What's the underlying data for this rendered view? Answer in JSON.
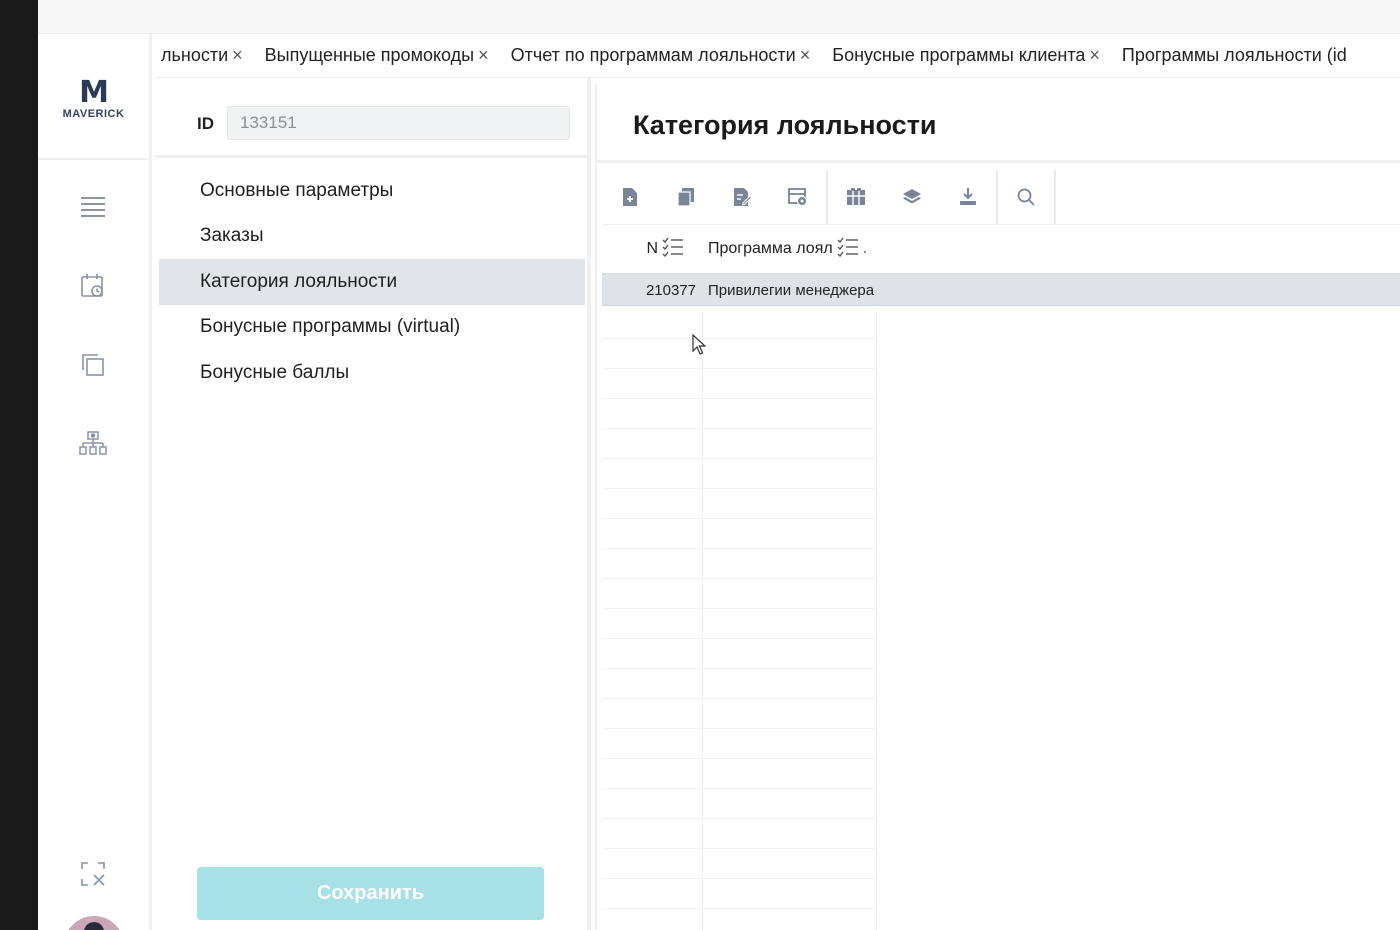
{
  "brand": {
    "logo_letter": "M",
    "logo_word": "MAVERICK"
  },
  "tabs": [
    {
      "label": "льности"
    },
    {
      "label": "Выпущенные промокоды"
    },
    {
      "label": "Отчет по программам лояльности"
    },
    {
      "label": "Бонусные программы клиента"
    },
    {
      "label": "Программы лояльности (id"
    }
  ],
  "tab_close_glyph": "×",
  "form": {
    "id_label": "ID",
    "id_value": "133151"
  },
  "nav": {
    "items": [
      {
        "label": "Основные параметры"
      },
      {
        "label": "Заказы"
      },
      {
        "label": "Категория лояльности"
      },
      {
        "label": "Бонусные программы (virtual)"
      },
      {
        "label": "Бонусные баллы"
      }
    ],
    "active_index": 2
  },
  "save_button": {
    "label": "Сохранить"
  },
  "panel": {
    "title": "Категория лояльности"
  },
  "toolbar": {
    "icons": [
      "add-document-icon",
      "copy-icon",
      "edit-icon",
      "table-settings-icon",
      "columns-icon",
      "layers-icon",
      "download-icon",
      "search-icon"
    ]
  },
  "grid": {
    "columns": [
      {
        "label": "N"
      },
      {
        "label": "Программа лоял"
      }
    ],
    "col2_ellipsis": ".",
    "rows": [
      {
        "n": "210377",
        "program": "Привилегии менеджера"
      }
    ]
  },
  "colors": {
    "save_button_bg": "#a7e1e8",
    "active_nav_bg": "#e1e4e9",
    "selected_row_bg": "#dfe3e8",
    "logo_accent": "#e9594a"
  }
}
